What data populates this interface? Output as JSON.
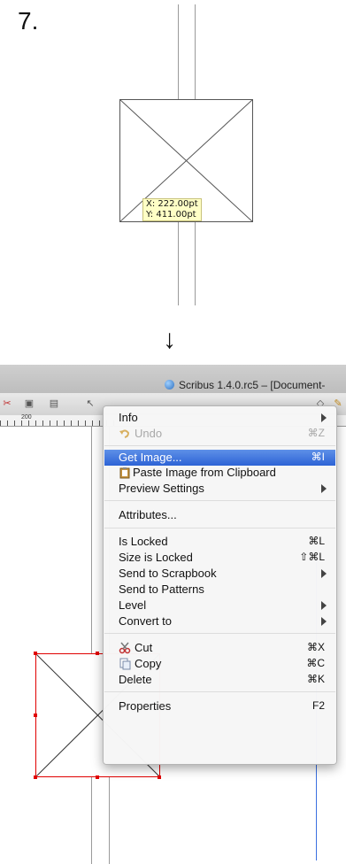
{
  "step": {
    "number": "7."
  },
  "coord_tooltip": {
    "x": "X: 222.00pt",
    "y": "Y: 411.00pt"
  },
  "arrow": "↓",
  "window": {
    "title": "Scribus 1.4.0.rc5 – [Document-"
  },
  "ruler": {
    "label": "200"
  },
  "context_menu": {
    "info": {
      "label": "Info"
    },
    "undo": {
      "label": "Undo",
      "shortcut": "⌘Z",
      "enabled": false
    },
    "get_image": {
      "label": "Get Image...",
      "shortcut": "⌘I",
      "highlighted": true
    },
    "paste_image": {
      "label": "Paste Image from Clipboard"
    },
    "preview_settings": {
      "label": "Preview Settings"
    },
    "attributes": {
      "label": "Attributes..."
    },
    "is_locked": {
      "label": "Is Locked",
      "shortcut": "⌘L"
    },
    "size_locked": {
      "label": "Size is Locked",
      "shortcut": "⇧⌘L"
    },
    "send_scrapbook": {
      "label": "Send to Scrapbook"
    },
    "send_patterns": {
      "label": "Send to Patterns"
    },
    "level": {
      "label": "Level"
    },
    "convert_to": {
      "label": "Convert to"
    },
    "cut": {
      "label": "Cut",
      "shortcut": "⌘X"
    },
    "copy": {
      "label": "Copy",
      "shortcut": "⌘C"
    },
    "delete": {
      "label": "Delete",
      "shortcut": "⌘K"
    },
    "properties": {
      "label": "Properties",
      "shortcut": "F2"
    }
  },
  "colors": {
    "menu_highlight": "#2d63d6",
    "selection_handles": "#e00000",
    "guide_blue": "#3a6fe0",
    "tooltip_bg": "#ffffc6"
  }
}
